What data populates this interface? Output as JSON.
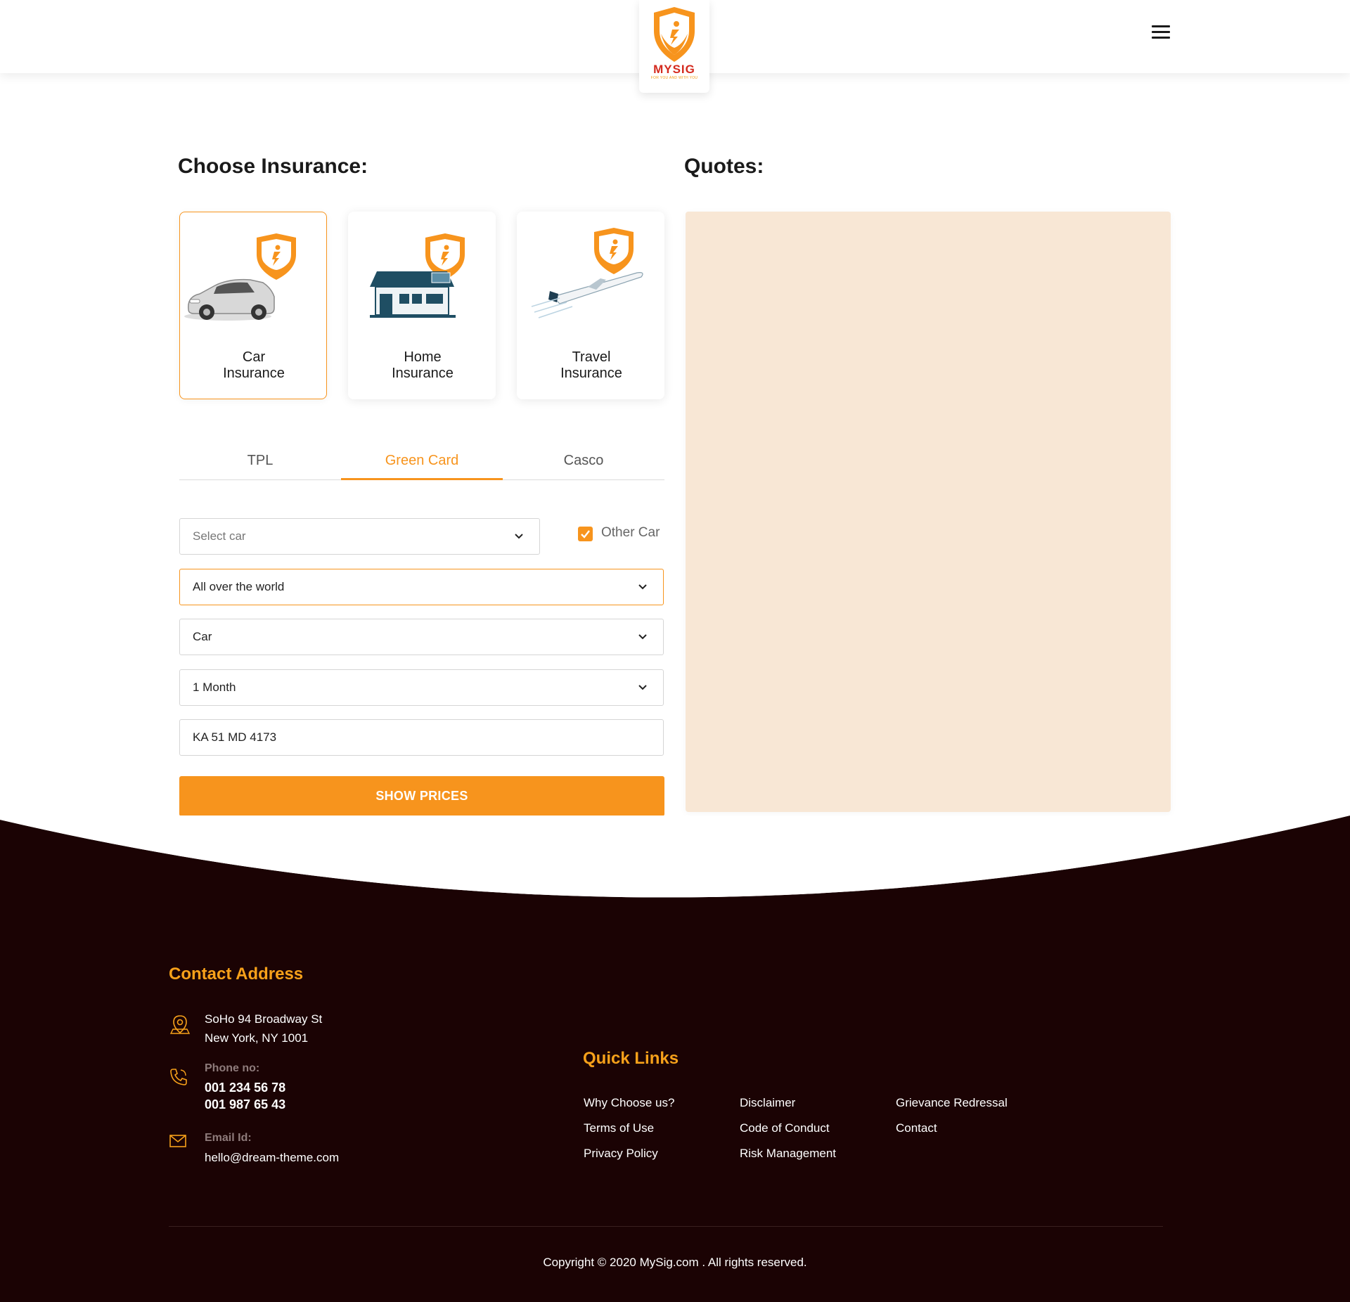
{
  "header": {
    "logo_name": "MYSIG",
    "logo_tagline": "FOR YOU AND WITH YOU"
  },
  "main": {
    "choose_title": "Choose Insurance:",
    "quotes_title": "Quotes:",
    "cards": [
      {
        "line1": "Car",
        "line2": "Insurance",
        "icon": "car-icon",
        "active": true
      },
      {
        "line1": "Home",
        "line2": "Insurance",
        "icon": "house-icon",
        "active": false
      },
      {
        "line1": "Travel",
        "line2": "Insurance",
        "icon": "airplane-icon",
        "active": false
      }
    ],
    "tabs": [
      {
        "label": "TPL",
        "active": false
      },
      {
        "label": "Green Card",
        "active": true
      },
      {
        "label": "Casco",
        "active": false
      }
    ],
    "form": {
      "select_car_placeholder": "Select car",
      "other_car_label": "Other Car",
      "other_car_checked": true,
      "territory": "All over the world",
      "vehicle_type": "Car",
      "duration": "1 Month",
      "plate_number": "KA 51 MD 4173",
      "submit_label": "SHOW PRICES"
    }
  },
  "footer": {
    "contact_heading": "Contact Address",
    "address_line1": "SoHo 94 Broadway St",
    "address_line2": "New York, NY 1001",
    "phone_label": "Phone no:",
    "phone1": "001 234 56 78",
    "phone2": "001 987 65 43",
    "email_label": "Email Id:",
    "email": "hello@dream-theme.com",
    "quick_links_heading": "Quick Links",
    "links": [
      "Why Choose us?",
      "Terms of Use",
      "Privacy Policy",
      "Disclaimer",
      "Code of Conduct",
      "Risk Management",
      "Grievance Redressal",
      "Contact"
    ],
    "copyright": "Copyright © 2020 MySig.com . All rights reserved."
  },
  "colors": {
    "accent": "#f7941d",
    "logo_red": "#d42a1e",
    "quotes_bg": "#f8e7d5",
    "footer_bg": "#1b0304",
    "footer_heading": "#f7a11a"
  }
}
